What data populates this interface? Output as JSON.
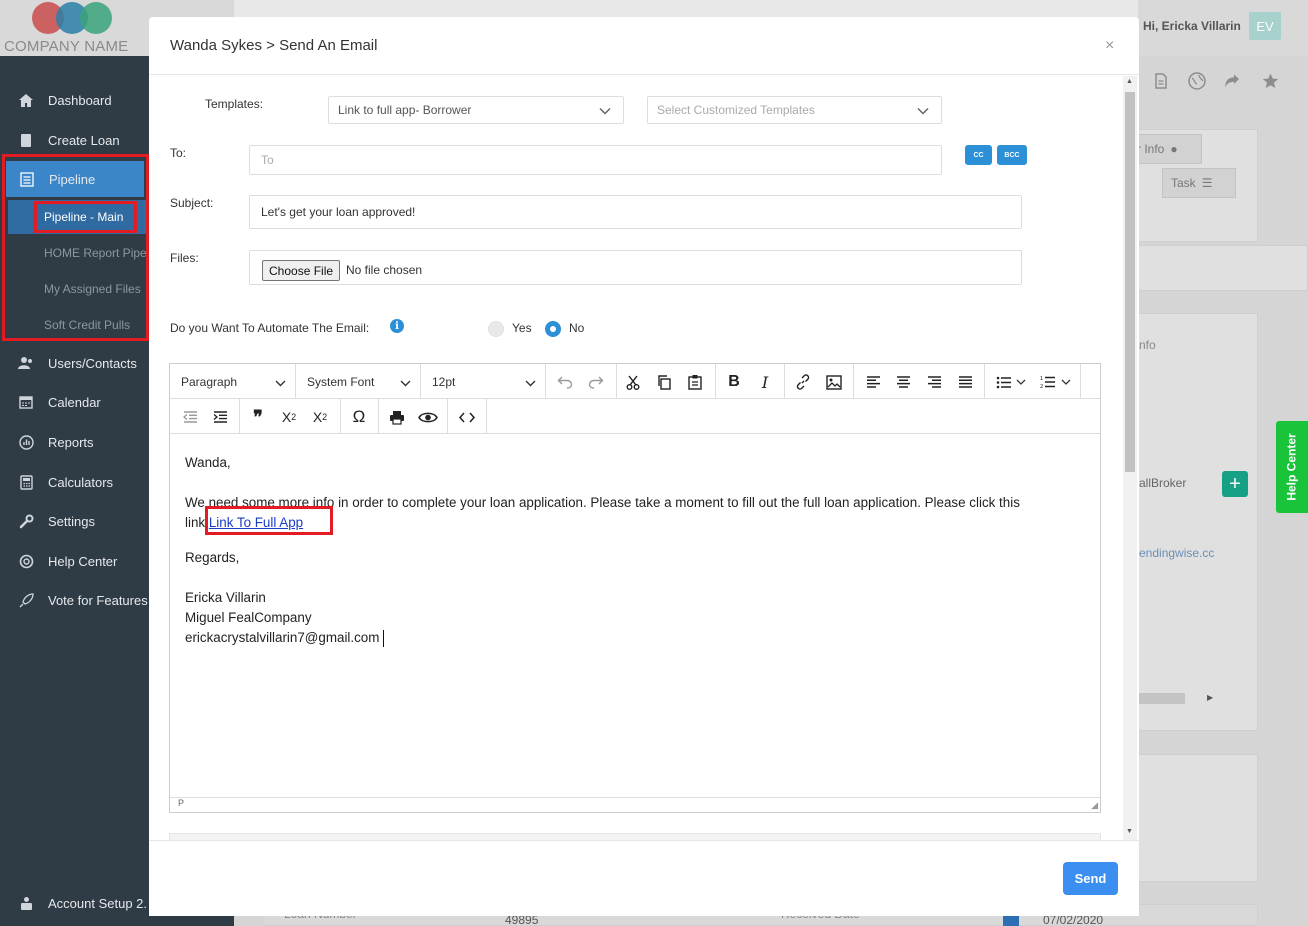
{
  "brand": {
    "logo_text": "COMPANY NAME",
    "colors": [
      "#c94b4b",
      "#2a7fa8",
      "#3aa37a"
    ]
  },
  "header": {
    "greeting": "Hi, Ericka Villarin",
    "avatar_initials": "EV"
  },
  "sidebar": {
    "items": [
      {
        "label": "Dashboard",
        "icon": "home-icon"
      },
      {
        "label": "Create Loan",
        "icon": "book-icon"
      },
      {
        "label": "Pipeline",
        "icon": "list-icon"
      },
      {
        "label": "Users/Contacts",
        "icon": "users-icon"
      },
      {
        "label": "Calendar",
        "icon": "calendar-icon"
      },
      {
        "label": "Reports",
        "icon": "reports-icon"
      },
      {
        "label": "Calculators",
        "icon": "calculator-icon"
      },
      {
        "label": "Settings",
        "icon": "wrench-icon"
      },
      {
        "label": "Help Center",
        "icon": "lifebuoy-icon"
      },
      {
        "label": "Vote for Features",
        "icon": "rocket-icon"
      }
    ],
    "pipeline_sub": [
      "Pipeline - Main",
      "HOME Report Pipe",
      "My Assigned Files",
      "Soft Credit Pulls"
    ],
    "footer_item": "Account Setup 2."
  },
  "background": {
    "tab_info": "r Info",
    "tab_task": "Task",
    "text_info": "nfo",
    "text_broker": "allBroker",
    "text_email": "endingwise.cc",
    "text_loan_number": "Loan Number",
    "text_loan_number_value": "49895",
    "text_received_date": "Received Date",
    "text_date_value": "07/02/2020",
    "help_center_tab": "Help Center"
  },
  "modal": {
    "title": "Wanda Sykes > Send An Email",
    "close": "×",
    "templates_label": "Templates:",
    "template_selected": "Link to full app- Borrower",
    "custom_template_placeholder": "Select Customized Templates",
    "to_label": "To:",
    "to_placeholder": "To",
    "cc_label": "CC",
    "bcc_label": "BCC",
    "subject_label": "Subject:",
    "subject_value": "Let's get your loan approved!",
    "files_label": "Files:",
    "choose_file": "Choose File",
    "file_status": "No file chosen",
    "automate_label": "Do you Want To Automate The Email:",
    "automate_options": [
      "Yes",
      "No"
    ],
    "automate_selected": "No",
    "send_label": "Send"
  },
  "editor": {
    "format": "Paragraph",
    "font": "System Font",
    "size": "12pt",
    "status_path": "P",
    "body": {
      "greeting": "Wanda,",
      "paragraph_line1": "We need some more info in order to complete your loan application. Please take a moment to fill out the full loan application. Please click this",
      "paragraph_line2_prefix": "link ",
      "link_text": "Link To Full App",
      "regards": "Regards,",
      "sig_name": "Ericka Villarin",
      "sig_company": "Miguel FealCompany",
      "sig_email": "erickacrystalvillarin7@gmail.com"
    }
  }
}
